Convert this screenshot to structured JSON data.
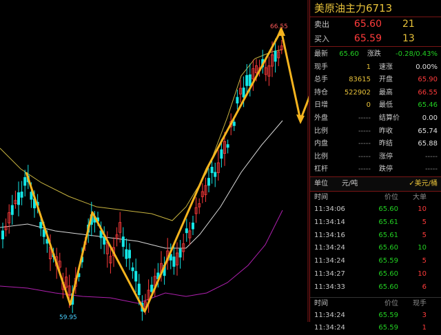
{
  "instrument": {
    "title": "美原油主力6713"
  },
  "quote": {
    "sell": {
      "label": "卖出",
      "price": "65.60",
      "volume": "21"
    },
    "buy": {
      "label": "买入",
      "price": "65.59",
      "volume": "13"
    }
  },
  "stats": [
    {
      "k": "最新",
      "v": "65.60",
      "vc": "green",
      "k2": "涨跌",
      "v2": "-0.28/0.43%",
      "v2c": "green"
    },
    {
      "k": "现手",
      "v": "1",
      "vc": "yel",
      "k2": "速涨",
      "v2": "0.00%",
      "v2c": "wht"
    },
    {
      "k": "总手",
      "v": "83615",
      "vc": "yel",
      "k2": "开盘",
      "v2": "65.90",
      "v2c": "red"
    },
    {
      "k": "持仓",
      "v": "522902",
      "vc": "yel",
      "k2": "最高",
      "v2": "66.55",
      "v2c": "red"
    },
    {
      "k": "日增",
      "v": "0",
      "vc": "yel",
      "k2": "最低",
      "v2": "65.46",
      "v2c": "green"
    },
    {
      "k": "外盘",
      "v": "-----",
      "vc": "grey",
      "k2": "结算价",
      "v2": "0.00",
      "v2c": "wht"
    },
    {
      "k": "比例",
      "v": "-----",
      "vc": "grey",
      "k2": "昨收",
      "v2": "65.74",
      "v2c": "wht"
    },
    {
      "k": "内盘",
      "v": "-----",
      "vc": "grey",
      "k2": "昨结",
      "v2": "65.88",
      "v2c": "wht"
    },
    {
      "k": "比例",
      "v": "-----",
      "vc": "grey",
      "k2": "涨停",
      "v2": "-----",
      "v2c": "grey"
    },
    {
      "k": "杠杆",
      "v": "-----",
      "vc": "grey",
      "k2": "跌停",
      "v2": "-----",
      "v2c": "grey"
    }
  ],
  "unit_bar": {
    "label": "单位",
    "cny": "元/吨",
    "usd": "✓美元/桶"
  },
  "tick_header": {
    "time": "时间",
    "price": "价位",
    "size": "大单"
  },
  "ticks": [
    {
      "time": "11:34:06",
      "price": "65.60",
      "size": "10",
      "sc": "red"
    },
    {
      "time": "11:34:14",
      "price": "65.61",
      "size": "5",
      "sc": "red"
    },
    {
      "time": "11:34:16",
      "price": "65.61",
      "size": "5",
      "sc": "red"
    },
    {
      "time": "11:34:24",
      "price": "65.60",
      "size": "10",
      "sc": "green"
    },
    {
      "time": "11:34:24",
      "price": "65.59",
      "size": "5",
      "sc": "red"
    },
    {
      "time": "11:34:27",
      "price": "65.60",
      "size": "10",
      "sc": "red"
    },
    {
      "time": "11:34:33",
      "price": "65.60",
      "size": "6",
      "sc": "red"
    }
  ],
  "tick2_header": {
    "time": "时间",
    "price": "价位",
    "size": "现手"
  },
  "ticks2": [
    {
      "time": "11:34:24",
      "price": "65.59",
      "size": "3",
      "sc": "red"
    },
    {
      "time": "11:34:24",
      "price": "65.59",
      "size": "1",
      "sc": "red"
    }
  ],
  "chart_labels": {
    "high": "66.55",
    "low": "59.95"
  },
  "colors": {
    "up": "#ff3b3b",
    "down": "#14e6e6",
    "zigzag": "#f5b41e",
    "ma": "#c8b440",
    "mid": "#dcdcdc",
    "vol": "#b020b0"
  }
}
